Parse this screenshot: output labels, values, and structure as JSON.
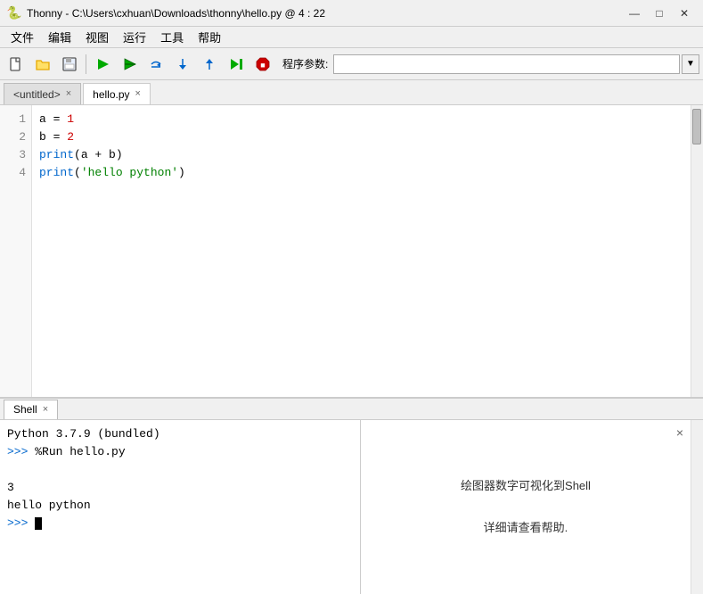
{
  "titlebar": {
    "icon": "🐍",
    "title": "Thonny  -  C:\\Users\\cxhuan\\Downloads\\thonny\\hello.py  @  4 : 22",
    "minimize": "—",
    "maximize": "□",
    "close": "✕"
  },
  "menubar": {
    "items": [
      "文件",
      "编辑",
      "视图",
      "运行",
      "工具",
      "帮助"
    ]
  },
  "toolbar": {
    "program_args_label": "程序参数:",
    "program_args_value": ""
  },
  "editor": {
    "tabs": [
      {
        "label": "<untitled>",
        "active": false,
        "closable": true
      },
      {
        "label": "hello.py",
        "active": true,
        "closable": true
      }
    ],
    "line_numbers": [
      "1",
      "2",
      "3",
      "4"
    ],
    "lines": [
      {
        "content": "a = 1"
      },
      {
        "content": "b = 2"
      },
      {
        "content": "print(a + b)"
      },
      {
        "content": "print('hello python')"
      }
    ]
  },
  "shell": {
    "tab_label": "Shell",
    "tab_close": "×",
    "lines": [
      {
        "type": "info",
        "text": "Python 3.7.9 (bundled)"
      },
      {
        "type": "prompt_cmd",
        "prompt": ">>> ",
        "text": "%Run hello.py"
      },
      {
        "type": "blank",
        "text": ""
      },
      {
        "type": "output",
        "text": "3"
      },
      {
        "type": "output",
        "text": "hello python"
      },
      {
        "type": "prompt_cursor",
        "prompt": ">>> ",
        "text": ""
      }
    ],
    "right_close": "×",
    "right_text1": "绘图器数字可视化到Shell",
    "right_text2": "详细请查看帮助."
  }
}
